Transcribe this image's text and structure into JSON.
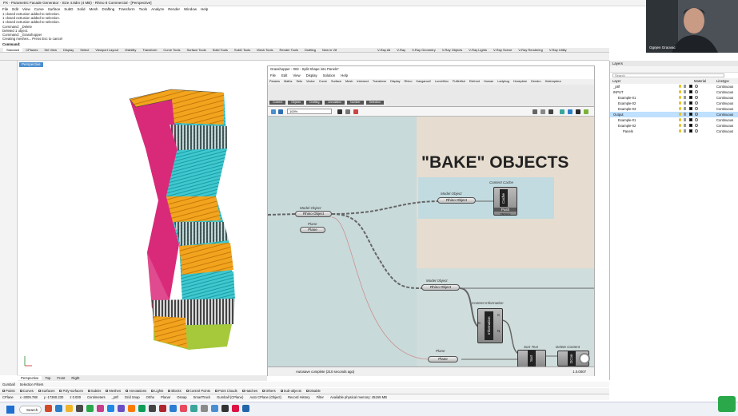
{
  "window": {
    "title": "PX - Parametric Facade Generator - Size 4.8dm (4 MB) - Rhino 8 Commercial - [Perspective]"
  },
  "menu": [
    "File",
    "Edit",
    "View",
    "Curve",
    "Surface",
    "SubD",
    "Solid",
    "Mesh",
    "Drafting",
    "Transform",
    "Tools",
    "Analyze",
    "Render",
    "Window",
    "Help"
  ],
  "command_log": [
    "1 closed extrusion added to selection.",
    "1 closed extrusion added to selection.",
    "1 closed extrusion added to selection.",
    "Command: _Delete",
    "Deleted 1 object.",
    "Command: _Grasshopper",
    "Creating meshes... Press Esc to cancel"
  ],
  "command_prompt": "Command:",
  "toolbar_tabs": [
    "Standard",
    "CPlanes",
    "Set View",
    "Display",
    "Select",
    "Viewport Layout",
    "Visibility",
    "Transform",
    "Curve Tools",
    "Surface Tools",
    "Solid Tools",
    "SubD Tools",
    "Mesh Tools",
    "Render Tools",
    "Drafting",
    "New in V8"
  ],
  "toolbar_tabs_right": [
    "V-Ray All",
    "V-Ray",
    "V-Ray Geometry",
    "V-Ray Objects",
    "V-Ray Lights",
    "V-Ray Scene",
    "V-Ray Rendering",
    "V-Ray Utility"
  ],
  "viewport": {
    "title": "Perspective",
    "tabs": [
      "Perspective",
      "Top",
      "Front",
      "Right"
    ],
    "active_tab": "Perspective"
  },
  "gh": {
    "title": "Grasshopper - 002 - Split Shape into Panels*",
    "doc_title": "002 - Split Shape into Panels*",
    "menu": [
      "File",
      "Edit",
      "View",
      "Display",
      "Solution",
      "Help"
    ],
    "tabs": [
      "Params",
      "Maths",
      "Sets",
      "Vector",
      "Curve",
      "Surface",
      "Mesh",
      "Intersect",
      "Transform",
      "Display",
      "Rhino",
      "Kangaroo2",
      "LunchBox",
      "Pufferfish",
      "Elefront",
      "Human",
      "Ladybug",
      "Honeybee",
      "Dendro",
      "Heteroptera"
    ],
    "categories": [
      "Content",
      "Objects",
      "Drafting",
      "Annotation",
      "Number",
      "Selection"
    ],
    "search_value": "100%",
    "status": "Autosave complete (210 seconds ago)",
    "status_right": "1.0.0007",
    "heading": "\"BAKE\" OBJECTS",
    "nodes": {
      "model_object_1": {
        "nick": "Model Object",
        "label": "Rhino Object"
      },
      "plane_1": {
        "nick": "Plane",
        "label": "Plane"
      },
      "model_object_2": {
        "nick": "Model Object",
        "label": "Rhino Object"
      },
      "content_cache": {
        "nick": "Content Cache",
        "label": "Cache",
        "button": "Push",
        "timer": "250ms"
      },
      "model_object_3": {
        "nick": "Model Object",
        "label": "Rhino Object"
      },
      "content_information": {
        "nick": "Content Information",
        "label": "Information",
        "ports": [
          "C",
          "C",
          "N"
        ]
      },
      "plane_2": {
        "nick": "Plane",
        "label": "Plane"
      },
      "sort_text": {
        "nick": "Sort Text",
        "label": "Sort",
        "ports": [
          "K",
          "V",
          "K",
          "V"
        ]
      },
      "delete_content": {
        "nick": "Delete Content",
        "label": "DCon"
      }
    }
  },
  "layers": {
    "title": "Layers",
    "search_placeholder": "Search",
    "columns": [
      "Layer",
      "Material",
      "Linetype"
    ],
    "rows": [
      {
        "name": "_p8f",
        "linetype": "Continuous",
        "color": "#000000",
        "indent": 0,
        "selected": false
      },
      {
        "name": "INPUT",
        "linetype": "Continuous",
        "color": "#000000",
        "indent": 0,
        "selected": false
      },
      {
        "name": "Example-01",
        "linetype": "Continuous",
        "color": "#000000",
        "indent": 1,
        "selected": false
      },
      {
        "name": "Example-02",
        "linetype": "Continuous",
        "color": "#000000",
        "indent": 1,
        "selected": false
      },
      {
        "name": "Example-03",
        "linetype": "Continuous",
        "color": "#000000",
        "indent": 1,
        "selected": false
      },
      {
        "name": "Output",
        "linetype": "Continuous",
        "color": "#000000",
        "indent": 0,
        "selected": true
      },
      {
        "name": "Example-01",
        "linetype": "Continuous",
        "color": "#000000",
        "indent": 1,
        "selected": false
      },
      {
        "name": "Example-02",
        "linetype": "Continuous",
        "color": "#000000",
        "indent": 1,
        "selected": false
      },
      {
        "name": "Panels",
        "linetype": "Continuous",
        "color": "#000000",
        "indent": 2,
        "selected": false
      }
    ]
  },
  "webcam": {
    "name": "Ognjen Graovac"
  },
  "command_tabs": [
    "Gumball",
    "Selection Filters"
  ],
  "osnap": [
    "Points",
    "Curves",
    "Surfaces",
    "Poly-surfaces",
    "SubDs",
    "Meshes",
    "Annotations",
    "Lights",
    "Blocks",
    "Control Points",
    "Point Clouds",
    "Hatches",
    "Others",
    "Sub-objects",
    "Disable"
  ],
  "statusbar": [
    "CPlane",
    "x -3009.788",
    "y -17360.230",
    "z 0.000",
    "Centimeters",
    "_p8f",
    "Grid Snap",
    "Ortho",
    "Planar",
    "Osnap",
    "SmartTrack",
    "Gumball (CPlane)",
    "Auto CPlane (Object)",
    "Record History",
    "Filter",
    "Available physical memory: 45159 MB"
  ],
  "taskbar": {
    "search": "Search"
  },
  "colors": {
    "accent": "#4a8ed0",
    "canvas": "#d9d9d6",
    "group_blue": "#b9dbe3",
    "group_tan": "#e6ddd0"
  }
}
